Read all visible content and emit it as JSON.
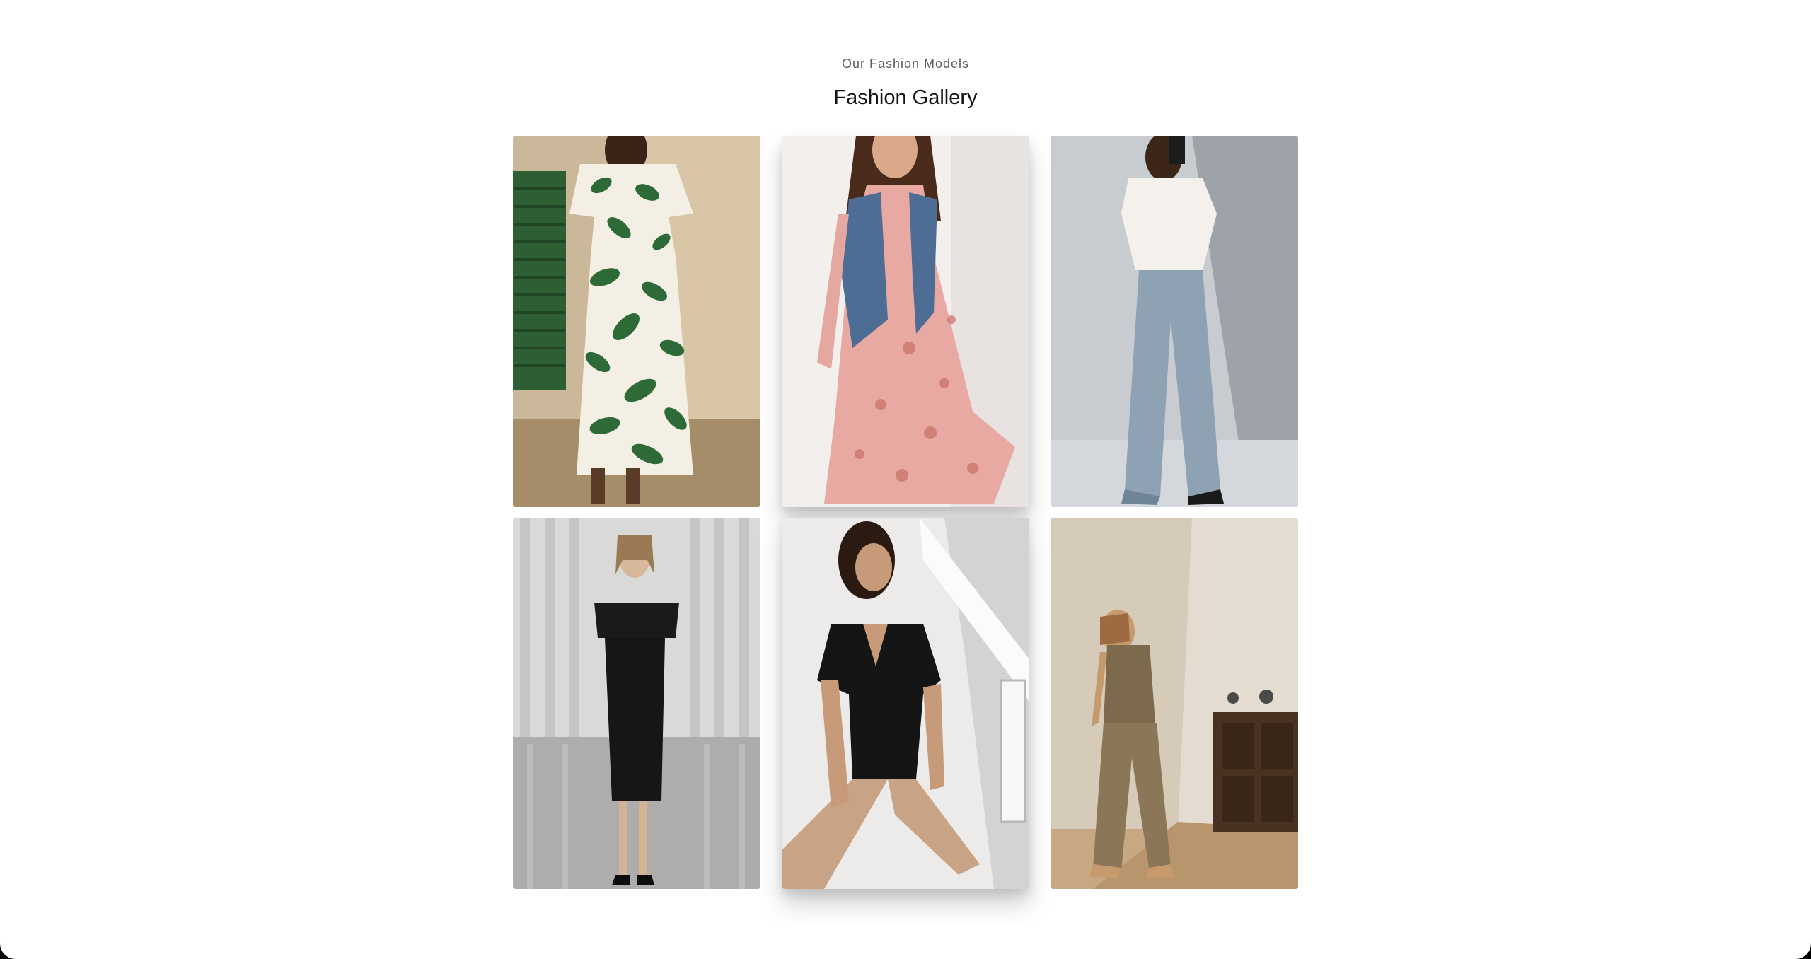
{
  "header": {
    "eyebrow": "Our Fashion Models",
    "title": "Fashion Gallery"
  },
  "gallery": {
    "items": [
      {
        "label": "Woman in green leaf print maxi dress",
        "palette": {
          "bg": "#cdbca0",
          "accent": "#2f6b3c"
        }
      },
      {
        "label": "Woman in pink floral dress with denim vest",
        "palette": {
          "bg": "#f2eeec",
          "accent": "#d98c86"
        }
      },
      {
        "label": "Woman in white wrap top and wide leg jeans",
        "palette": {
          "bg": "#c9ccd0",
          "accent": "#8fa3b0"
        }
      },
      {
        "label": "Woman in black off-shoulder midi dress on runway",
        "palette": {
          "bg": "#d7d7d6",
          "accent": "#1a1a1a"
        }
      },
      {
        "label": "Woman in black v-neck bodysuit",
        "palette": {
          "bg": "#ebebe9",
          "accent": "#161616"
        }
      },
      {
        "label": "Woman in khaki vest and trousers against white wall",
        "palette": {
          "bg": "#e6dfd4",
          "accent": "#8a7a5c"
        }
      }
    ]
  }
}
